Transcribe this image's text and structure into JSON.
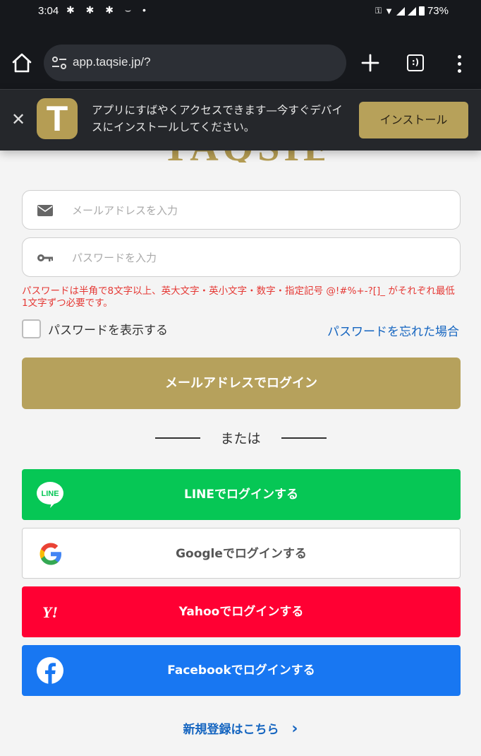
{
  "status_bar": {
    "time": "3:04",
    "left_icons": "✱ ✱ ✱ ⌣ •",
    "battery": "73%"
  },
  "browser": {
    "url": "app.taqsie.jp/?"
  },
  "install_banner": {
    "app_icon_letter": "T",
    "message": "アプリにすばやくアクセスできます—今すぐデバイスにインストールしてください。",
    "install_label": "インストール"
  },
  "brand": {
    "logo_text": "TAQSIE"
  },
  "form": {
    "email_placeholder": "メールアドレスを入力",
    "password_placeholder": "パスワードを入力",
    "password_rule": "パスワードは半角で8文字以上、英大文字・英小文字・数字・指定記号 @!#%+-?[]_ がそれぞれ最低1文字ずつ必要です。",
    "show_password_label": "パスワードを表示する",
    "forgot_password_label": "パスワードを忘れた場合",
    "email_login_label": "メールアドレスでログイン"
  },
  "divider": {
    "label": "または"
  },
  "social": {
    "line_label": "LINEでログインする",
    "line_icon_text": "LINE",
    "google_label": "Googleでログインする",
    "yahoo_label": "Yahooでログインする",
    "yahoo_icon_text": "Y!",
    "facebook_label": "Facebookでログインする"
  },
  "signup": {
    "label": "新規登録はこちら",
    "chevron": "›"
  },
  "colors": {
    "brand_gold": "#b59d54",
    "line_green": "#06c755",
    "yahoo_red": "#ff0033",
    "facebook_blue": "#1877f2",
    "link_blue": "#1565c0",
    "error_red": "#e53935"
  }
}
